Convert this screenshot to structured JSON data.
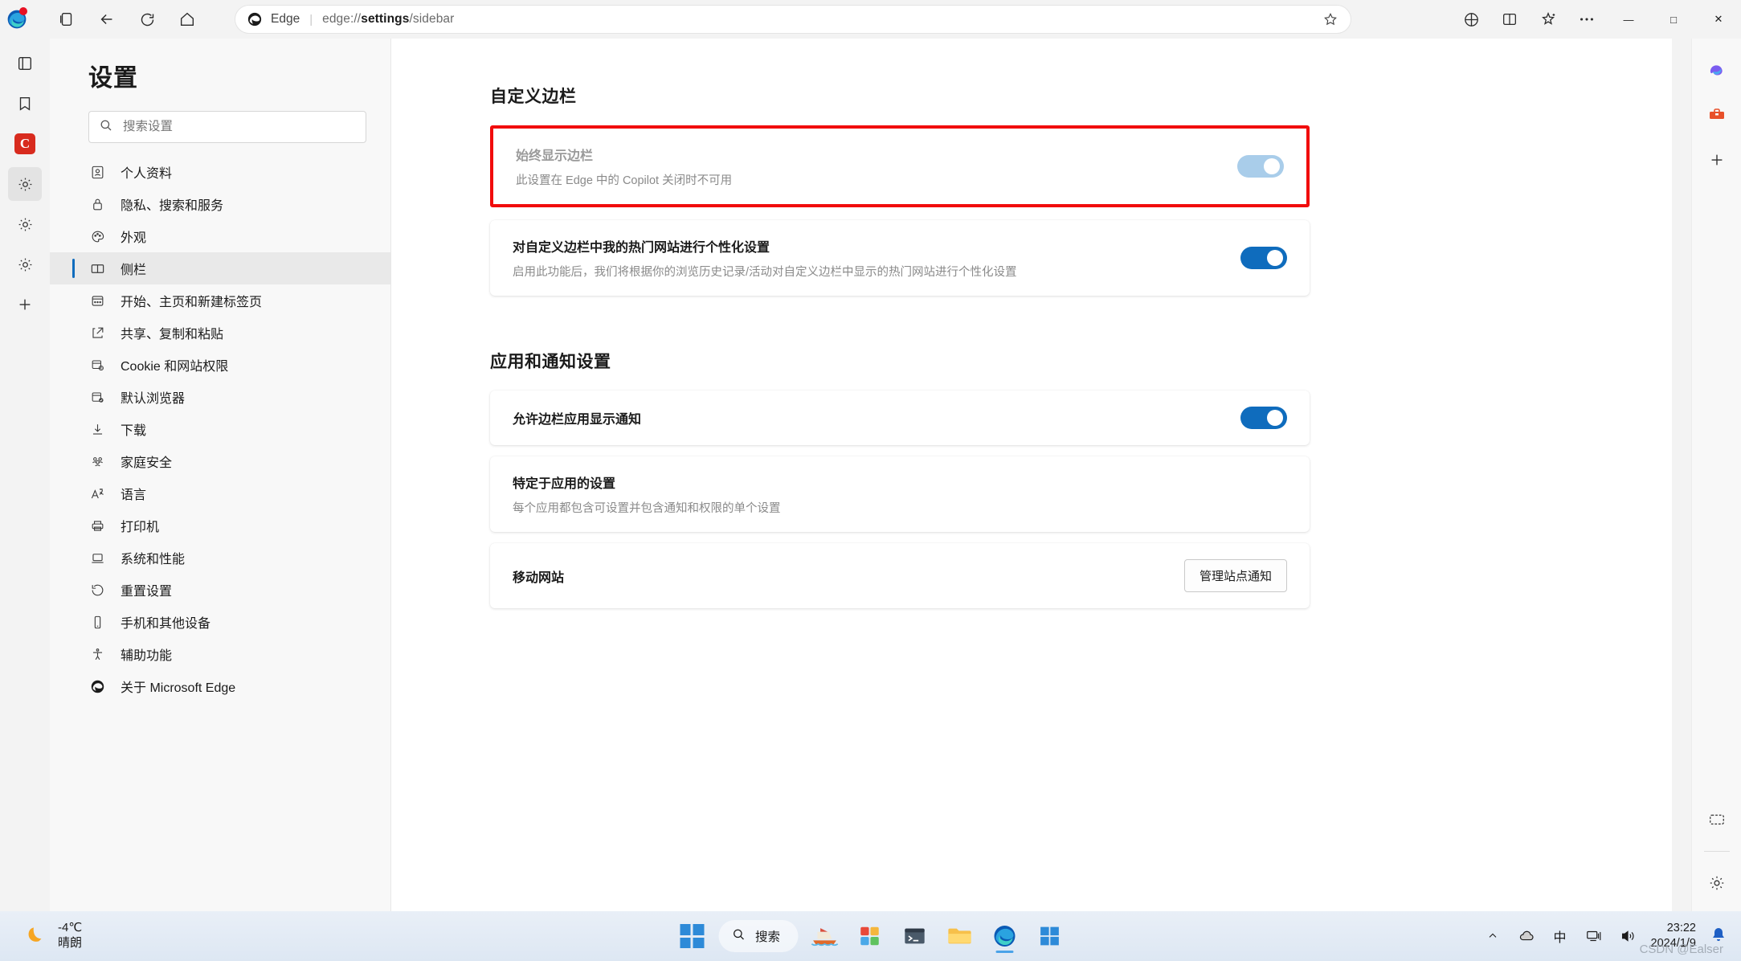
{
  "browser": {
    "address": {
      "label": "Edge",
      "url_prefix": "edge://",
      "url_bold": "settings",
      "url_suffix": "/sidebar"
    },
    "toolbar_icons": [
      "edge-logo",
      "tab-collection-icon",
      "back-icon",
      "refresh-icon",
      "home-icon",
      "favorite-star-icon",
      "extensions-icon",
      "split-screen-icon",
      "collections-icon",
      "more-icon"
    ],
    "window_controls": {
      "minimize": "—",
      "maximize": "□",
      "close": "✕"
    }
  },
  "settings": {
    "title": "设置",
    "search": {
      "placeholder": "搜索设置"
    },
    "nav_items": [
      {
        "label": "个人资料",
        "icon": "profile-icon",
        "selected": false
      },
      {
        "label": "隐私、搜索和服务",
        "icon": "lock-icon",
        "selected": false
      },
      {
        "label": "外观",
        "icon": "palette-icon",
        "selected": false
      },
      {
        "label": "侧栏",
        "icon": "sidebar-icon",
        "selected": true
      },
      {
        "label": "开始、主页和新建标签页",
        "icon": "window-icon",
        "selected": false
      },
      {
        "label": "共享、复制和粘贴",
        "icon": "share-icon",
        "selected": false
      },
      {
        "label": "Cookie 和网站权限",
        "icon": "cookie-permissions-icon",
        "selected": false
      },
      {
        "label": "默认浏览器",
        "icon": "default-browser-icon",
        "selected": false
      },
      {
        "label": "下载",
        "icon": "download-icon",
        "selected": false
      },
      {
        "label": "家庭安全",
        "icon": "family-icon",
        "selected": false
      },
      {
        "label": "语言",
        "icon": "language-icon",
        "selected": false
      },
      {
        "label": "打印机",
        "icon": "printer-icon",
        "selected": false
      },
      {
        "label": "系统和性能",
        "icon": "system-icon",
        "selected": false
      },
      {
        "label": "重置设置",
        "icon": "reset-icon",
        "selected": false
      },
      {
        "label": "手机和其他设备",
        "icon": "phone-icon",
        "selected": false
      },
      {
        "label": "辅助功能",
        "icon": "accessibility-icon",
        "selected": false
      },
      {
        "label": "关于 Microsoft Edge",
        "icon": "edge-icon",
        "selected": false
      }
    ]
  },
  "content": {
    "section_one_title": "自定义边栏",
    "always_show": {
      "title": "始终显示边栏",
      "subtitle": "此设置在 Edge 中的 Copilot 关闭时不可用",
      "toggle_state": "on-disabled"
    },
    "personalize": {
      "title": "对自定义边栏中我的热门网站进行个性化设置",
      "subtitle": "启用此功能后，我们将根据你的浏览历史记录/活动对自定义边栏中显示的热门网站进行个性化设置",
      "toggle_state": "on"
    },
    "section_two_title": "应用和通知设置",
    "allow_notifications": {
      "title": "允许边栏应用显示通知",
      "toggle_state": "on"
    },
    "app_specific": {
      "title": "特定于应用的设置",
      "subtitle": "每个应用都包含可设置并包含通知和权限的单个设置"
    },
    "mobile_sites": {
      "title": "移动网站",
      "button_label": "管理站点通知"
    }
  },
  "taskbar": {
    "weather": {
      "temperature": "-4℃",
      "condition": "晴朗"
    },
    "search_placeholder": "搜索",
    "clock": {
      "time": "23:22",
      "date": "2024/1/9"
    },
    "ime": "中",
    "watermark": "CSDN @Ealser"
  },
  "colors": {
    "accent": "#0f6cbd",
    "highlight_border": "#f10c0c",
    "toggle_on": "#0f6cbd",
    "toggle_disabled": "#a9cdea"
  }
}
